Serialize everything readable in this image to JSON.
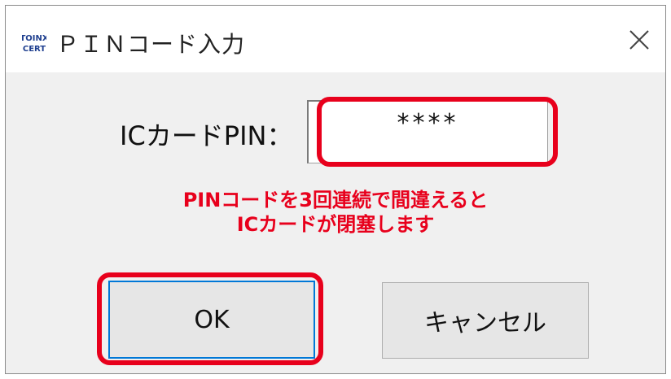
{
  "window": {
    "title": "ＰＩＮコード入力",
    "logo_icon": "toinx-cert-logo",
    "close_icon": "close-icon"
  },
  "form": {
    "pin_label": "ICカードPIN：",
    "pin_value": "****"
  },
  "warning": {
    "line1": "PINコードを3回連続で間違えると",
    "line2": "ICカードが閉塞します",
    "color": "#e8001c"
  },
  "buttons": {
    "ok_label": "OK",
    "cancel_label": "キャンセル"
  },
  "annotation": {
    "highlight_color": "#e8001c"
  },
  "logo": {
    "line1": "TOINX",
    "line2": "CERT"
  }
}
